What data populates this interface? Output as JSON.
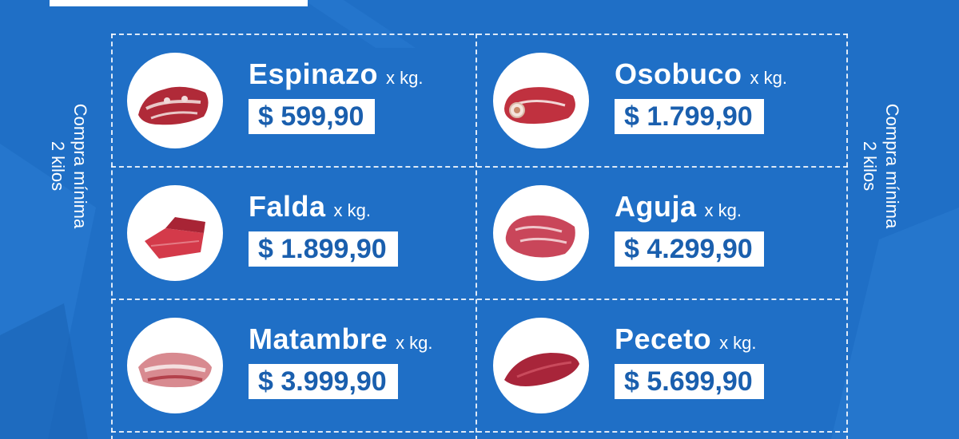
{
  "side_note": {
    "line1": "Compra mínima",
    "line2": "2 kilos"
  },
  "unit_label": "x kg.",
  "products": [
    {
      "name": "Espinazo",
      "price": "$ 599,90",
      "image": "espinazo-meat-icon"
    },
    {
      "name": "Osobuco",
      "price": "$ 1.799,90",
      "image": "osobuco-meat-icon"
    },
    {
      "name": "Falda",
      "price": "$ 1.899,90",
      "image": "falda-meat-icon"
    },
    {
      "name": "Aguja",
      "price": "$ 4.299,90",
      "image": "aguja-meat-icon"
    },
    {
      "name": "Matambre",
      "price": "$ 3.999,90",
      "image": "matambre-meat-icon"
    },
    {
      "name": "Peceto",
      "price": "$ 5.699,90",
      "image": "peceto-meat-icon"
    }
  ],
  "colors": {
    "background": "#1f6fc6",
    "price_text": "#1a5fae",
    "meat": "#c0313f"
  }
}
